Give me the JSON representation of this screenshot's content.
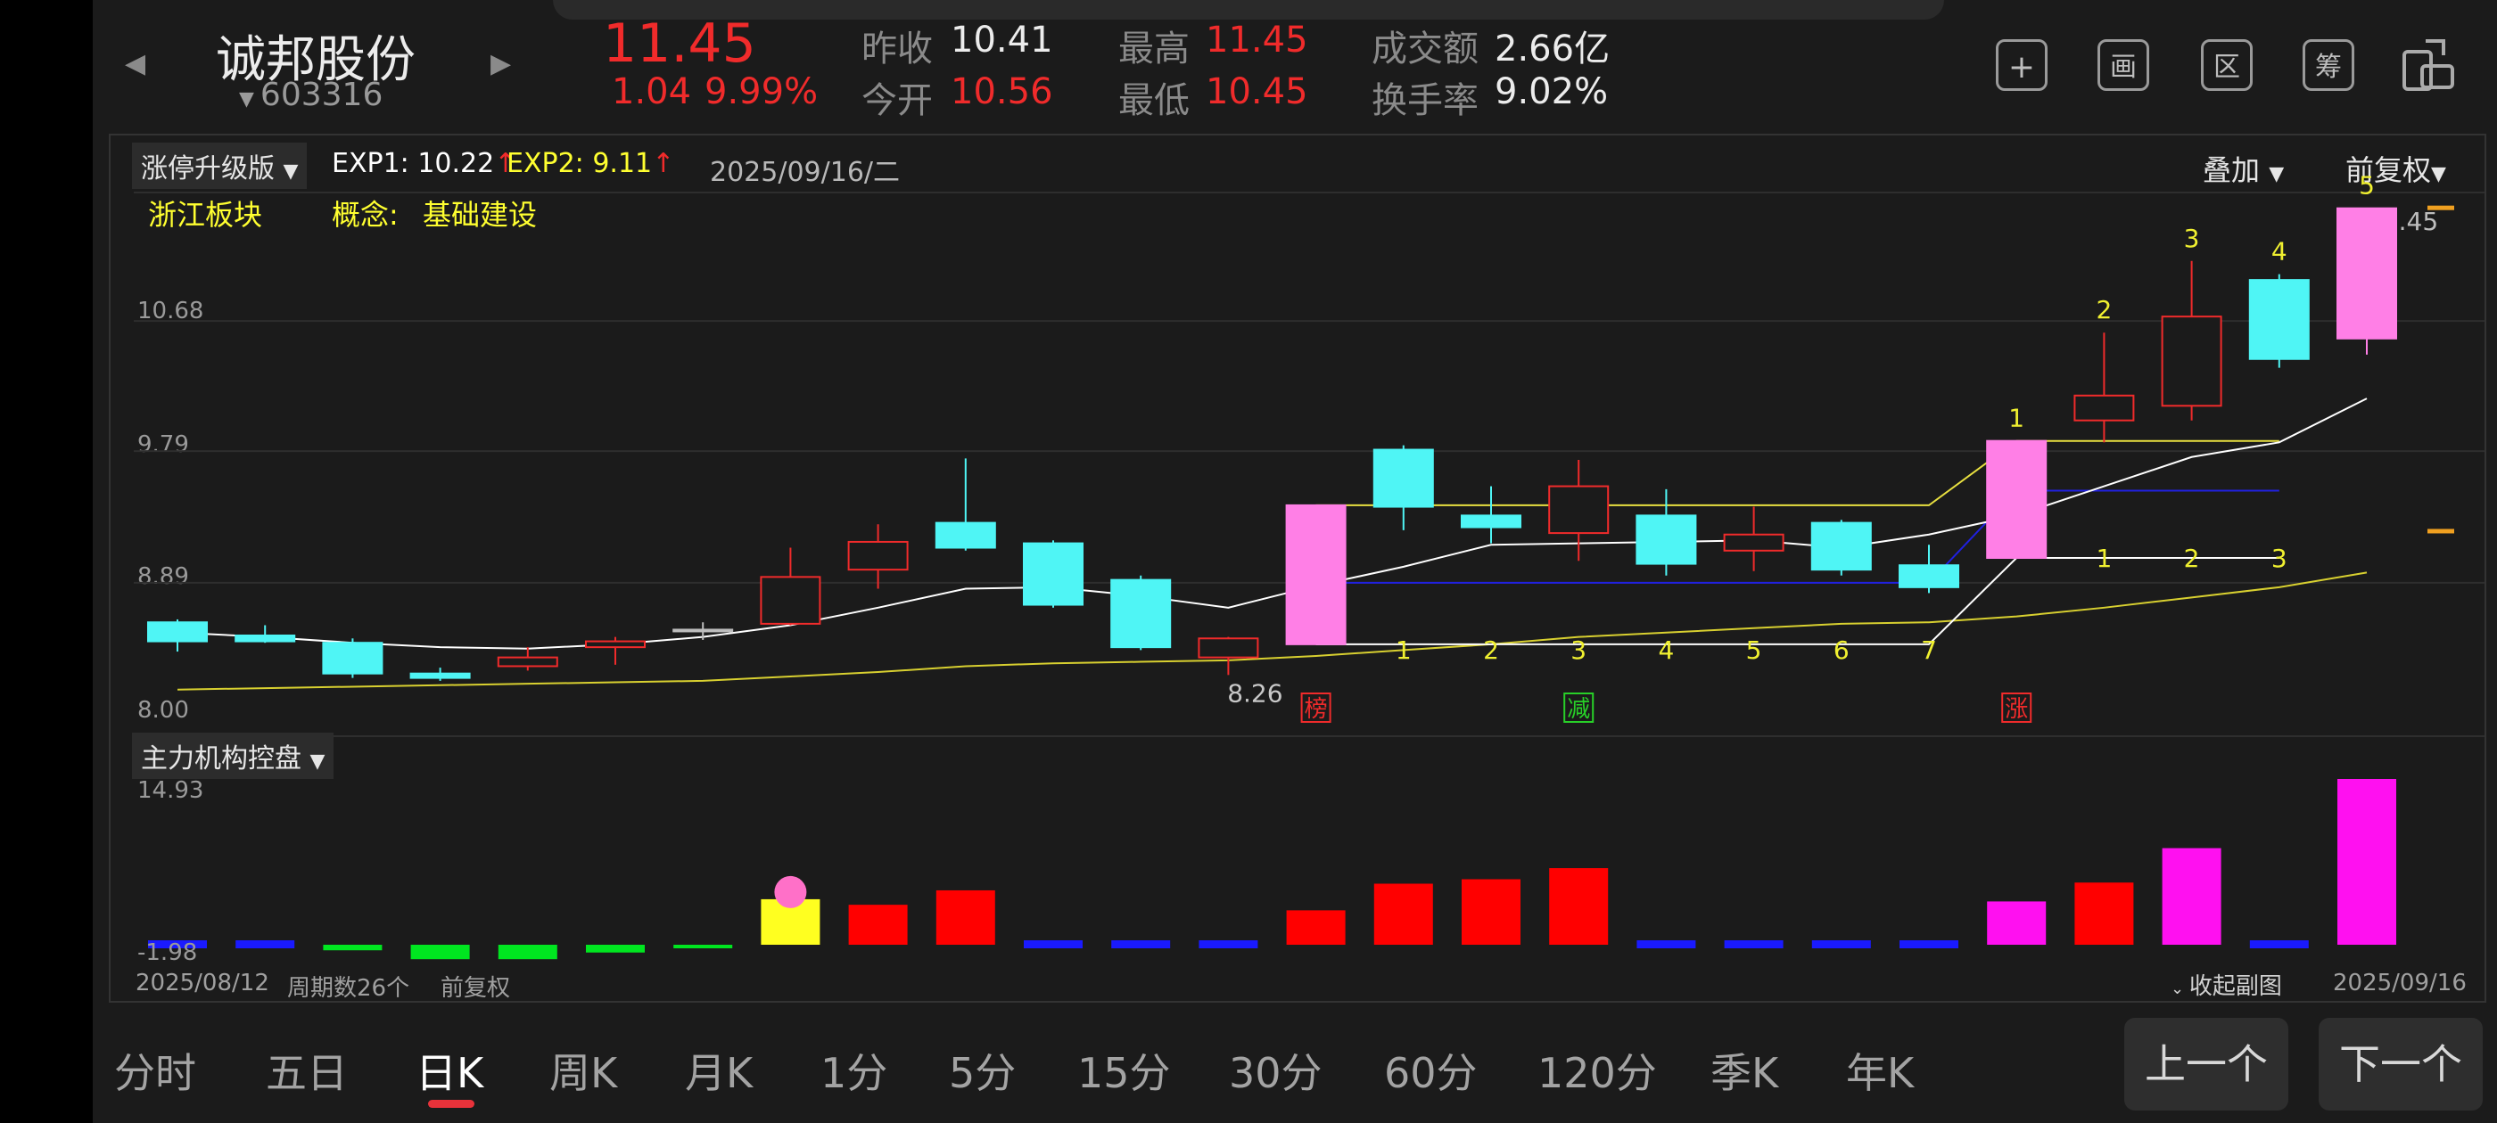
{
  "stock": {
    "name": "诚邦股份",
    "code": "603316",
    "price": "11.45",
    "change": "1.04",
    "change_pct": "9.99%"
  },
  "quote": {
    "prev_close_label": "昨收",
    "prev_close": "10.41",
    "open_label": "今开",
    "open": "10.56",
    "high_label": "最高",
    "high": "11.45",
    "low_label": "最低",
    "low": "10.45",
    "amount_label": "成交额",
    "amount": "2.66亿",
    "turnover_label": "换手率",
    "turnover": "9.02%"
  },
  "toolbar": [
    "plus-square-icon",
    "drawing-icon",
    "range-icon",
    "chip-distribution-icon",
    "rotate-screen-icon"
  ],
  "tool_glyphs": [
    "+",
    "画",
    "区",
    "筹",
    ""
  ],
  "main_chart": {
    "indicator": "涨停升级版",
    "exp1_label": "EXP1:",
    "exp1": "10.22",
    "exp2_label": "EXP2:",
    "exp2": "9.11",
    "date": "2025/09/16/二",
    "overlay_label": "叠加",
    "adjust_label": "前复权",
    "sector": "浙江板块",
    "concept_label": "概念:",
    "concept": "基础建设",
    "yticks": [
      "10.68",
      "9.79",
      "8.89",
      "8.00"
    ],
    "last_price_label": "11.45",
    "low_label": "8.26",
    "markers": [
      "榜",
      "减",
      "涨"
    ]
  },
  "sub_chart": {
    "indicator": "主力机构控盘",
    "ymax": "14.93",
    "ymin": "-1.98"
  },
  "footer": {
    "start_date": "2025/08/12",
    "period_count": "周期数26个",
    "adjust": "前复权",
    "collapse": "收起副图",
    "end_date": "2025/09/16"
  },
  "periods": [
    "分时",
    "五日",
    "日K",
    "周K",
    "月K",
    "1分",
    "5分",
    "15分",
    "30分",
    "60分",
    "120分",
    "季K",
    "年K"
  ],
  "active_period": "日K",
  "nav": {
    "prev": "上一个",
    "next": "下一个"
  },
  "colors": {
    "up": "#f02b2b",
    "down": "#4ff5f5",
    "limit": "#ff7fe6",
    "volume_up": "#ff0000",
    "volume_down": "#00e620",
    "accent": "#e8323a"
  },
  "chart_data": {
    "type": "candlestick",
    "ylim": [
      8.0,
      11.57
    ],
    "candles": [
      {
        "o": 8.62,
        "c": 8.49,
        "h": 8.64,
        "l": 8.42,
        "t": "down"
      },
      {
        "o": 8.53,
        "c": 8.49,
        "h": 8.6,
        "l": 8.48,
        "t": "down"
      },
      {
        "o": 8.48,
        "c": 8.27,
        "h": 8.51,
        "l": 8.24,
        "t": "down"
      },
      {
        "o": 8.27,
        "c": 8.24,
        "h": 8.31,
        "l": 8.22,
        "t": "down"
      },
      {
        "o": 8.32,
        "c": 8.38,
        "h": 8.45,
        "l": 8.29,
        "t": "up"
      },
      {
        "o": 8.45,
        "c": 8.49,
        "h": 8.52,
        "l": 8.33,
        "t": "up"
      },
      {
        "o": 8.57,
        "c": 8.57,
        "h": 8.62,
        "l": 8.5,
        "t": "flat"
      },
      {
        "o": 8.61,
        "c": 8.93,
        "h": 9.13,
        "l": 8.6,
        "t": "up"
      },
      {
        "o": 8.98,
        "c": 9.17,
        "h": 9.29,
        "l": 8.85,
        "t": "up"
      },
      {
        "o": 9.3,
        "c": 9.13,
        "h": 9.74,
        "l": 9.11,
        "t": "down"
      },
      {
        "o": 9.16,
        "c": 8.74,
        "h": 9.18,
        "l": 8.72,
        "t": "down"
      },
      {
        "o": 8.91,
        "c": 8.45,
        "h": 8.94,
        "l": 8.43,
        "t": "down"
      },
      {
        "o": 8.38,
        "c": 8.51,
        "h": 8.52,
        "l": 8.26,
        "t": "up"
      },
      {
        "o": 8.47,
        "c": 9.42,
        "h": 9.42,
        "l": 8.47,
        "t": "limit"
      },
      {
        "o": 9.8,
        "c": 9.41,
        "h": 9.83,
        "l": 9.25,
        "t": "down"
      },
      {
        "o": 9.35,
        "c": 9.27,
        "h": 9.55,
        "l": 9.16,
        "t": "down"
      },
      {
        "o": 9.55,
        "c": 9.23,
        "h": 9.73,
        "l": 9.04,
        "t": "up"
      },
      {
        "o": 9.35,
        "c": 9.02,
        "h": 9.53,
        "l": 8.94,
        "t": "down"
      },
      {
        "o": 9.11,
        "c": 9.22,
        "h": 9.41,
        "l": 8.97,
        "t": "up"
      },
      {
        "o": 9.3,
        "c": 8.98,
        "h": 9.32,
        "l": 8.94,
        "t": "down"
      },
      {
        "o": 9.01,
        "c": 8.86,
        "h": 9.15,
        "l": 8.82,
        "t": "down"
      },
      {
        "o": 9.06,
        "c": 9.86,
        "h": 9.86,
        "l": 9.06,
        "t": "limit"
      },
      {
        "o": 10.0,
        "c": 10.17,
        "h": 10.6,
        "l": 9.85,
        "t": "up"
      },
      {
        "o": 10.1,
        "c": 10.71,
        "h": 11.09,
        "l": 10.0,
        "t": "up"
      },
      {
        "o": 10.96,
        "c": 10.42,
        "h": 11.0,
        "l": 10.36,
        "t": "down"
      },
      {
        "o": 10.56,
        "c": 11.45,
        "h": 11.45,
        "l": 10.45,
        "t": "limit"
      }
    ],
    "ma_white": [
      8.55,
      8.52,
      8.48,
      8.45,
      8.44,
      8.47,
      8.52,
      8.6,
      8.72,
      8.85,
      8.86,
      8.8,
      8.72,
      8.87,
      9.0,
      9.15,
      9.16,
      9.17,
      9.18,
      9.13,
      9.22,
      9.35,
      9.55,
      9.75,
      9.85,
      10.15
    ],
    "ma_yellow": [
      8.16,
      8.17,
      8.18,
      8.19,
      8.2,
      8.21,
      8.22,
      8.25,
      8.28,
      8.32,
      8.34,
      8.35,
      8.36,
      8.39,
      8.43,
      8.47,
      8.52,
      8.55,
      8.58,
      8.61,
      8.62,
      8.66,
      8.72,
      8.79,
      8.86,
      8.96
    ],
    "sub_values": [
      0.0,
      0.0,
      -0.5,
      -1.3,
      -1.3,
      -0.7,
      -0.2,
      4.1,
      3.6,
      4.9,
      0.0,
      0.0,
      0.0,
      3.1,
      5.5,
      5.9,
      6.9,
      0.0,
      0.0,
      0.0,
      0.0,
      3.9,
      5.6,
      8.7,
      0.0,
      14.93
    ],
    "sub_types": [
      "blue",
      "blue",
      "green",
      "green",
      "green",
      "green",
      "green",
      "yellow",
      "red",
      "red",
      "blue",
      "blue",
      "blue",
      "red",
      "red",
      "red",
      "red",
      "blue",
      "blue",
      "blue",
      "blue",
      "magenta",
      "red",
      "magenta",
      "blue",
      "magenta"
    ],
    "count_labels_bottom": [
      "1",
      "2",
      "3",
      "4",
      "5",
      "6",
      "7"
    ],
    "count_labels_mid": [
      "1",
      "2",
      "3"
    ],
    "count_labels_top": [
      "1",
      "2",
      "3",
      "4",
      "5"
    ]
  }
}
